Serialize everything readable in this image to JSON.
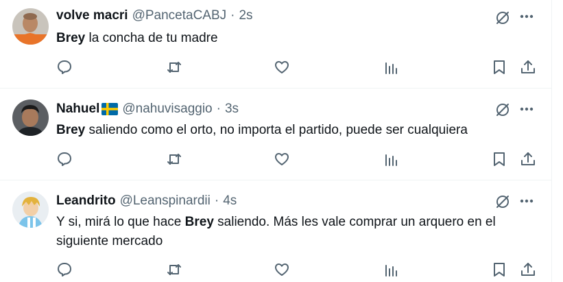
{
  "tweets": [
    {
      "name": "volve macri",
      "has_flag": false,
      "handle": "@PancetaCABJ",
      "time": "2s",
      "keyword": "Brey",
      "rest": " la concha de tu madre"
    },
    {
      "name": "Nahuel",
      "has_flag": true,
      "flag_icon": "sweden-flag-icon",
      "handle": "@nahuvisaggio",
      "time": "3s",
      "keyword": "Brey",
      "rest": " saliendo como el orto, no importa el partido, puede ser cualquiera"
    },
    {
      "name": "Leandrito",
      "has_flag": false,
      "handle": "@Leanspinardii",
      "time": "4s",
      "prefix": "Y si, mirá lo que hace ",
      "keyword": "Brey",
      "rest": " saliendo. Más les vale comprar un arquero en el siguiente mercado"
    }
  ],
  "separator": "·",
  "icons": {
    "grok": "grok-icon",
    "more": "more-dots-icon",
    "reply": "reply-icon",
    "retweet": "retweet-icon",
    "like": "like-heart-icon",
    "views": "views-bars-icon",
    "bookmark": "bookmark-icon",
    "share": "share-icon"
  },
  "colors": {
    "text": "#0f1419",
    "secondary": "#536471",
    "divider": "#eff3f4",
    "background": "#ffffff"
  }
}
